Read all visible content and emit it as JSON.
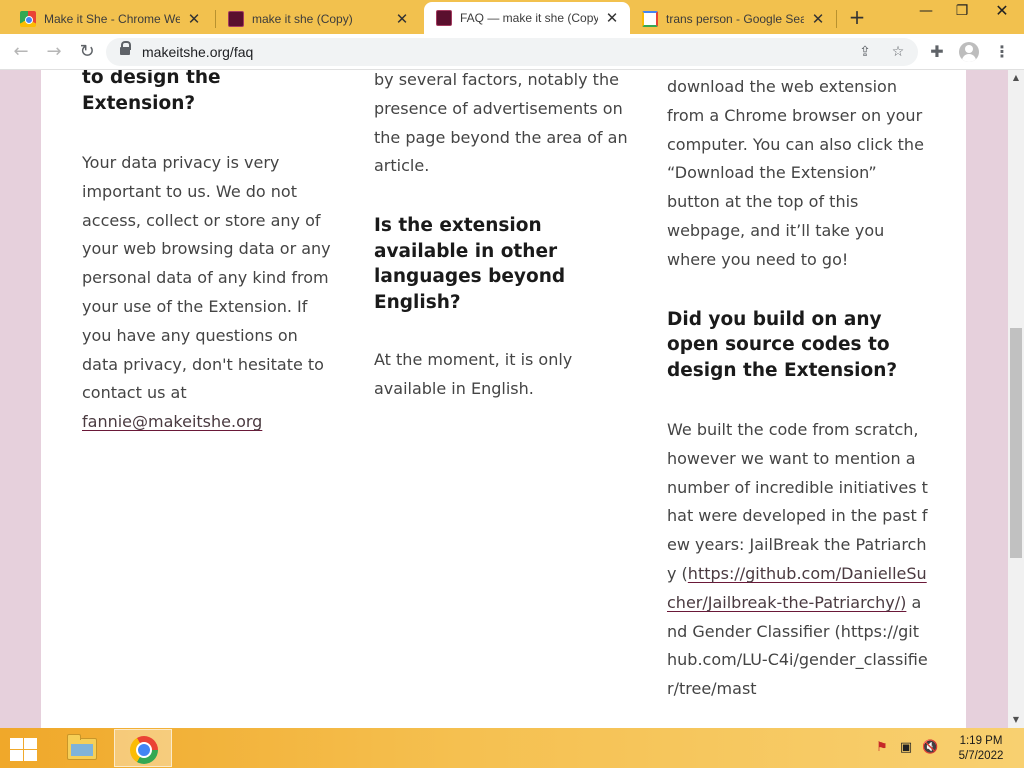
{
  "tabs": [
    {
      "title": "Make it She - Chrome Web",
      "favicon": "chrome-web-store-icon",
      "active": false
    },
    {
      "title": "make it she (Copy)",
      "favicon": "make-it-she-icon",
      "active": false
    },
    {
      "title": "FAQ — make it she (Copy)",
      "favicon": "make-it-she-icon",
      "active": true
    },
    {
      "title": "trans person - Google Sear",
      "favicon": "google-icon",
      "active": false
    }
  ],
  "toolbar": {
    "url": "makeitshe.org/faq"
  },
  "faq": {
    "col1": {
      "heading_tail": "to design the Extension?",
      "body": "Your data privacy is very important to us. We do not access, collect or store any of your web browsing data or any personal data of any kind from your use of the Extension. If you have any questions on data privacy, don't hesitate to contact us at",
      "email": "fannie@makeitshe.org"
    },
    "col2": {
      "body_tail": "by several factors, notably the presence of advertisements on the page beyond the area of an article.",
      "question": "Is the extension available in other languages beyond English?",
      "answer": "At the moment, it is only available in English."
    },
    "col3": {
      "body_tail": "download the web extension from a Chrome browser on your computer. You can also click the “Download the Extension” button at the top of this webpage, and it’ll take you where you need to go!",
      "question": "Did you build on any open source codes to design the Extension?",
      "answer_intro": "We built the code from scratch, however we want to mention a number of incredible initiatives that were developed in the past few years: JailBreak the Patriarchy (",
      "link1": "https://github.com/DanielleSucher/Jailbreak-the-Patriarchy/)",
      "answer_mid": "and Gender Classifier (https://github.com/LU-C4i/gender_classifier/tree/mast"
    }
  },
  "taskbar": {
    "time": "1:19 PM",
    "date": "5/7/2022"
  },
  "colors": {
    "tabstrip": "#f2c14e",
    "page_background": "#e6d0dc",
    "link_underline": "#6a1838",
    "taskbar": "#f5c050"
  }
}
